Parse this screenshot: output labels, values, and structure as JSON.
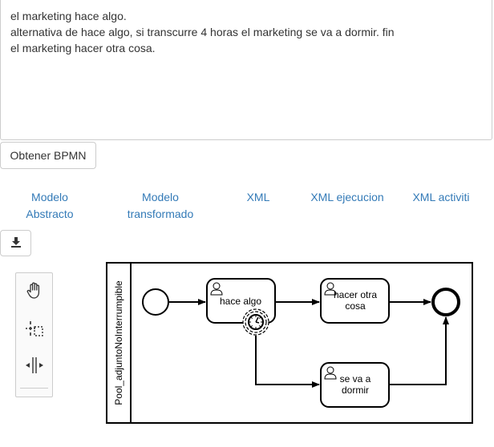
{
  "editor": {
    "lines": [
      "el marketing hace algo.",
      "alternativa de hace algo, si transcurre 4 horas el marketing se va a dormir. fin",
      "el marketing hacer otra cosa."
    ]
  },
  "toolbar": {
    "obtener_label": "Obtener BPMN"
  },
  "tabs": [
    {
      "line1": "Modelo",
      "line2": "Abstracto"
    },
    {
      "line1": "Modelo",
      "line2": "transformado"
    },
    {
      "line1": "XML",
      "line2": ""
    },
    {
      "line1": "XML ejecucion",
      "line2": ""
    },
    {
      "line1": "XML activiti",
      "line2": ""
    }
  ],
  "download": {
    "icon": "download-icon"
  },
  "palette": {
    "tools": [
      "hand-tool-icon",
      "lasso-tool-icon",
      "space-tool-icon"
    ]
  },
  "diagram": {
    "pool_label": "Pool_adjuntoNoInterrumpible",
    "tasks": {
      "task1": [
        "hace algo"
      ],
      "task2": [
        "hacer otra",
        "cosa"
      ],
      "task3": [
        "se va a",
        "dormir"
      ]
    },
    "colors": {
      "stroke": "#000000",
      "fill": "#ffffff"
    }
  }
}
